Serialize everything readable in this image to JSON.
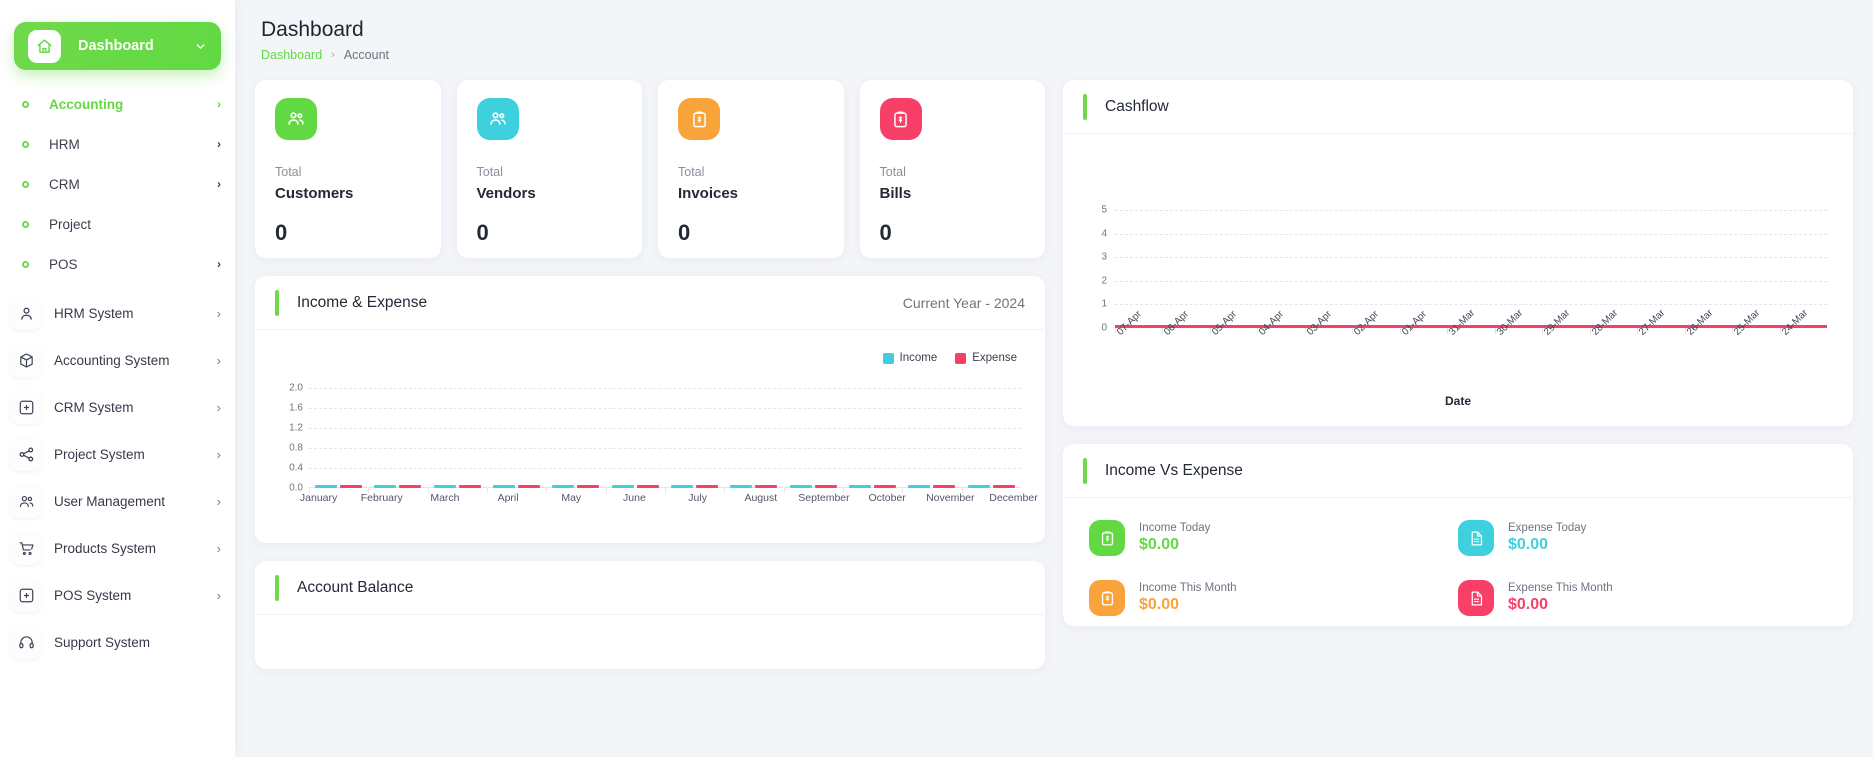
{
  "sidebar": {
    "brand": {
      "label": "Dashboard",
      "icon": "home-icon",
      "caret": "chevron-down-icon"
    },
    "items": [
      {
        "label": "Accounting",
        "active": true,
        "chevron": "›"
      },
      {
        "label": "HRM",
        "active": false,
        "chevron": "›"
      },
      {
        "label": "CRM",
        "active": false,
        "chevron": "›"
      },
      {
        "label": "Project",
        "active": false,
        "chevron": ""
      },
      {
        "label": "POS",
        "active": false,
        "chevron": "›"
      }
    ],
    "systems": [
      {
        "label": "HRM System",
        "icon": "user-icon"
      },
      {
        "label": "Accounting System",
        "icon": "box-icon"
      },
      {
        "label": "CRM System",
        "icon": "window-plus-icon"
      },
      {
        "label": "Project System",
        "icon": "share-nodes-icon"
      },
      {
        "label": "User Management",
        "icon": "users-icon"
      },
      {
        "label": "Products System",
        "icon": "cart-icon"
      },
      {
        "label": "POS System",
        "icon": "window-plus-icon"
      },
      {
        "label": "Support System",
        "icon": "headset-icon"
      }
    ]
  },
  "header": {
    "title": "Dashboard",
    "breadcrumb_home": "Dashboard",
    "breadcrumb_sep": "›",
    "breadcrumb_current": "Account"
  },
  "stats": [
    {
      "total": "Total",
      "name": "Customers",
      "value": "0",
      "color": "#62d943",
      "icon": "users-icon"
    },
    {
      "total": "Total",
      "name": "Vendors",
      "value": "0",
      "color": "#3fd0dd",
      "icon": "users-icon"
    },
    {
      "total": "Total",
      "name": "Invoices",
      "value": "0",
      "color": "#f9a43a",
      "icon": "invoice-icon"
    },
    {
      "total": "Total",
      "name": "Bills",
      "value": "0",
      "color": "#f73f67",
      "icon": "invoice-icon"
    }
  ],
  "income_expense": {
    "title": "Income & Expense",
    "period": "Current Year - 2024"
  },
  "cashflow": {
    "title": "Cashflow"
  },
  "income_vs_expense": {
    "title": "Income Vs Expense",
    "items": [
      {
        "label": "Income Today",
        "value": "$0.00",
        "color": "#62d943",
        "icon": "invoice-icon"
      },
      {
        "label": "Expense Today",
        "value": "$0.00",
        "color": "#3fd0dd",
        "icon": "file-icon"
      },
      {
        "label": "Income This Month",
        "value": "$0.00",
        "color": "#f9a43a",
        "icon": "invoice-icon"
      },
      {
        "label": "Expense This Month",
        "value": "$0.00",
        "color": "#f73f67",
        "icon": "file-icon"
      }
    ]
  },
  "account_balance": {
    "title": "Account Balance"
  },
  "chart_data": [
    {
      "type": "bar",
      "title": "Income & Expense",
      "subtitle": "Current Year - 2024",
      "categories": [
        "January",
        "February",
        "March",
        "April",
        "May",
        "June",
        "July",
        "August",
        "September",
        "October",
        "November",
        "December"
      ],
      "series": [
        {
          "name": "Income",
          "color": "#3fd0dd",
          "values": [
            0,
            0,
            0,
            0,
            0,
            0,
            0,
            0,
            0,
            0,
            0,
            0
          ]
        },
        {
          "name": "Expense",
          "color": "#f73f67",
          "values": [
            0,
            0,
            0,
            0,
            0,
            0,
            0,
            0,
            0,
            0,
            0,
            0
          ]
        }
      ],
      "yticks": [
        "2.0",
        "1.6",
        "1.2",
        "0.8",
        "0.4",
        "0.0"
      ],
      "ylim": [
        0,
        2
      ],
      "xlabel": "",
      "ylabel": "",
      "grid": true,
      "legend": "top-right"
    },
    {
      "type": "line",
      "title": "Cashflow",
      "x": [
        "07-Apr",
        "06-Apr",
        "05-Apr",
        "04-Apr",
        "03-Apr",
        "02-Apr",
        "01-Apr",
        "31-Mar",
        "30-Mar",
        "29-Mar",
        "28-Mar",
        "27-Mar",
        "26-Mar",
        "25-Mar",
        "24-Mar"
      ],
      "series": [
        {
          "name": "Cashflow",
          "color": "#f73f67",
          "values": [
            0,
            0,
            0,
            0,
            0,
            0,
            0,
            0,
            0,
            0,
            0,
            0,
            0,
            0,
            0
          ]
        }
      ],
      "yticks": [
        "5",
        "4",
        "3",
        "2",
        "1",
        "0"
      ],
      "ylim": [
        0,
        5
      ],
      "xlabel": "Date",
      "ylabel": "",
      "grid": true,
      "legend": "none"
    }
  ]
}
